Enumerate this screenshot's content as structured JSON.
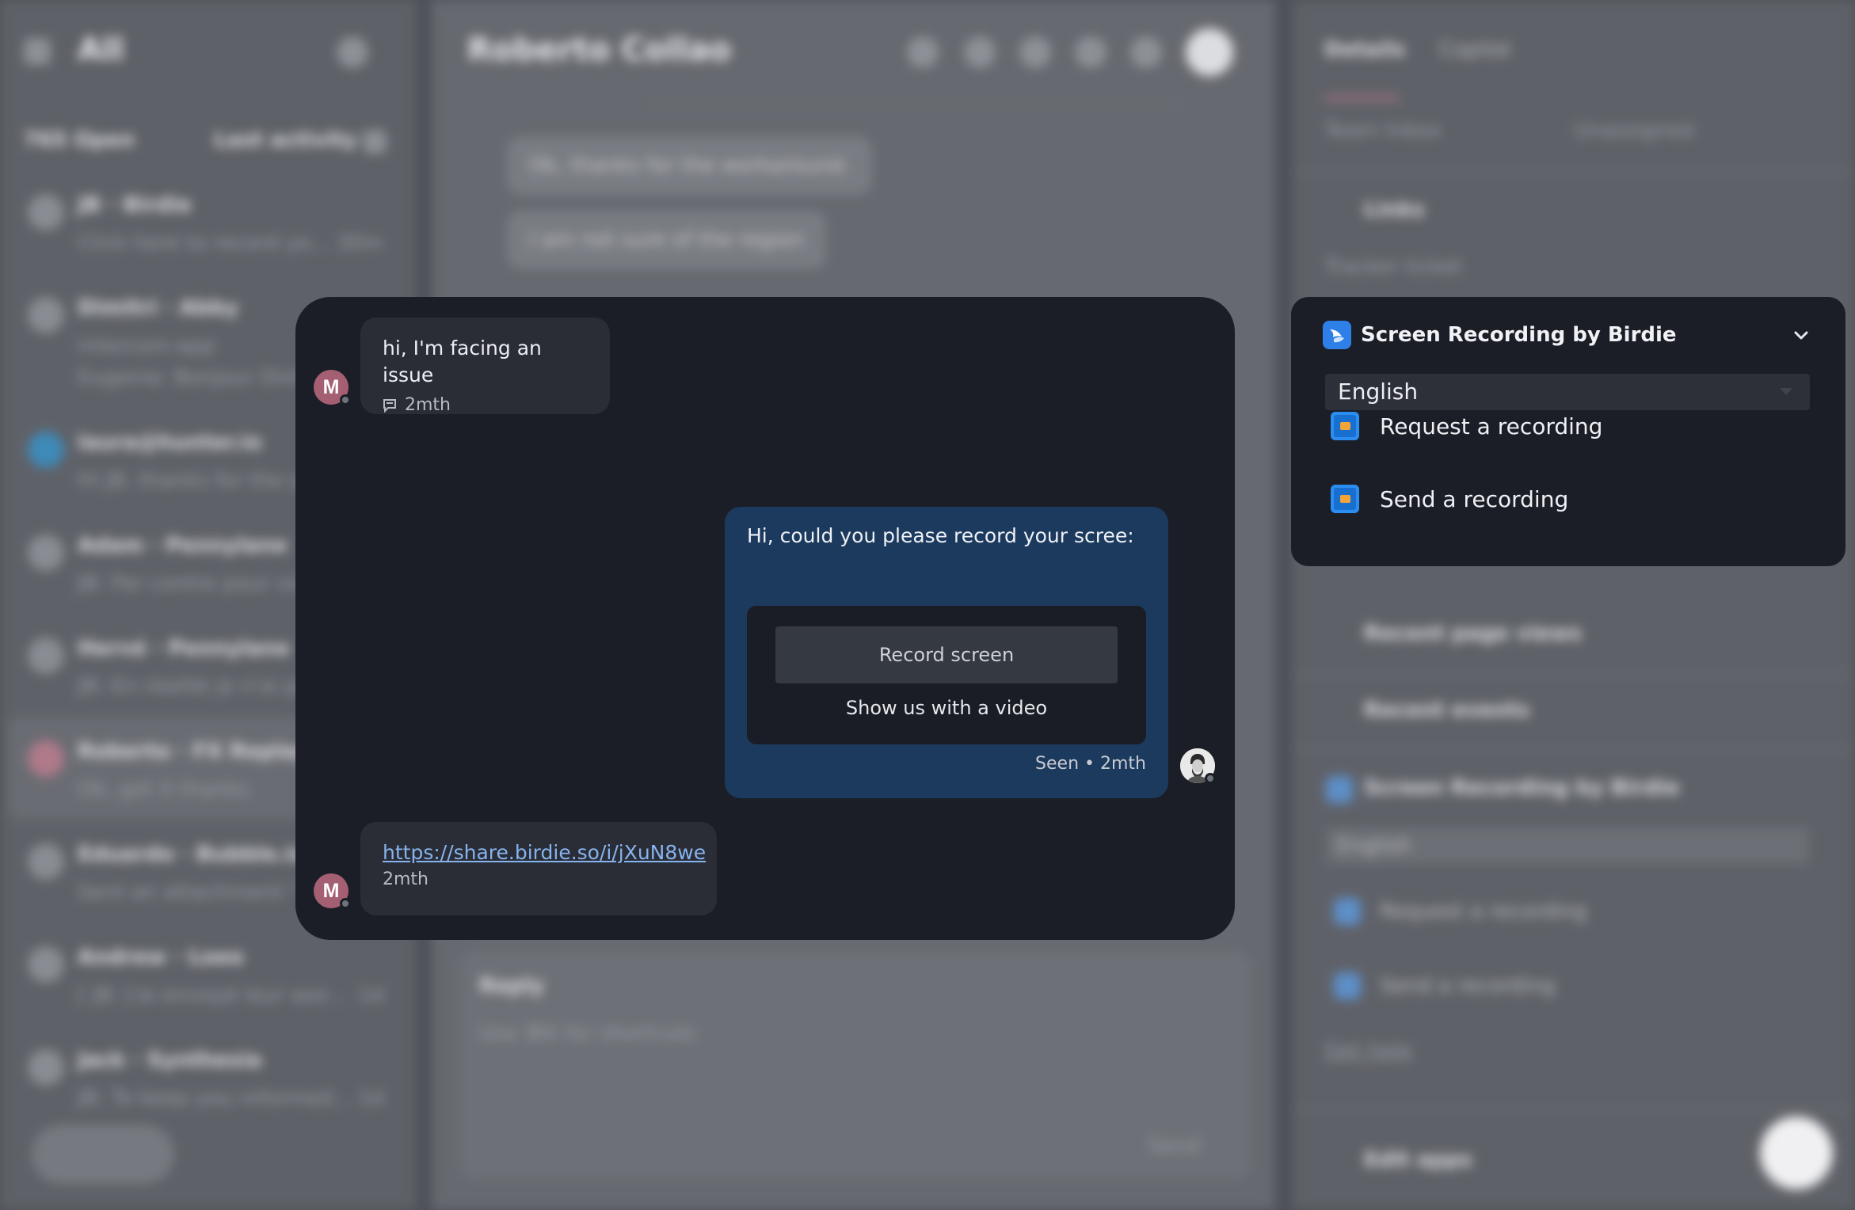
{
  "background": {
    "sidebar": {
      "title": "All",
      "open_count": "765 Open",
      "sort_label": "Last activity",
      "conversations": [
        {
          "name": "JB · Birdie",
          "preview": "Click here to record yo...",
          "time": "30m"
        },
        {
          "name": "Dimitri · Abby",
          "preview": "intercom-app",
          "preview2": "Eugenia: Bonjour Dimi"
        },
        {
          "name": "laura@hunter.io",
          "preview": "Hi JB, thanks for the q"
        },
        {
          "name": "Adam · Pennylane",
          "preview": "JB: Par contre pour vo"
        },
        {
          "name": "Hervé · Pennylane",
          "preview": "JB: En réalité je n'ai pa"
        },
        {
          "name": "Roberto · FX Replay",
          "preview": "Ok, got it thanks"
        },
        {
          "name": "Eduardo · Bubble.io",
          "preview": "Sent an attachment \""
        },
        {
          "name": "Andrew · Loeo",
          "preview": "[ JB: J'ai envoyé leur wor...",
          "time": "1d"
        },
        {
          "name": "Jack · Synthesia",
          "preview": "JB: To keep you informed...",
          "time": "1d"
        }
      ]
    },
    "conversation": {
      "title": "Roberto Collao",
      "messages": [
        "Ok, thanks for the workaround.",
        "I am not sure of the region"
      ],
      "reply_label": "Reply",
      "composer_placeholder": "Use ⌘K for shortcuts",
      "send_label": "Send"
    },
    "details": {
      "tabs": [
        "Details",
        "Copilot"
      ],
      "team_inbox": "Team Inbox",
      "assignee": "Unassigned",
      "links_label": "Links",
      "tracker_label": "Tracker ticket",
      "recent_page_views": "Recent page views",
      "recent_events": "Recent events",
      "app_title": "Screen Recording by Birdie",
      "language": "English",
      "request_label": "Request a recording",
      "send_label": "Send a recording",
      "help_label": "Get help",
      "edit_apps": "Edit apps"
    }
  },
  "chat": {
    "customer_initial": "M",
    "message1": {
      "text": "hi, I'm facing an issue",
      "time": "2mth"
    },
    "agent_message": {
      "text": "Hi, could you please record your scree:",
      "button_label": "Record screen",
      "subtitle": "Show us with a video",
      "seen": "Seen",
      "time": "2mth"
    },
    "message2": {
      "link": "https://share.birdie.so/i/jXuN8we",
      "time": "2mth"
    }
  },
  "app_panel": {
    "title": "Screen Recording by Birdie",
    "language": "English",
    "actions": [
      {
        "label": "Request a recording",
        "icon": "record-icon"
      },
      {
        "label": "Send a recording",
        "icon": "record-icon"
      }
    ],
    "accent_color": "#2f7fe8"
  }
}
